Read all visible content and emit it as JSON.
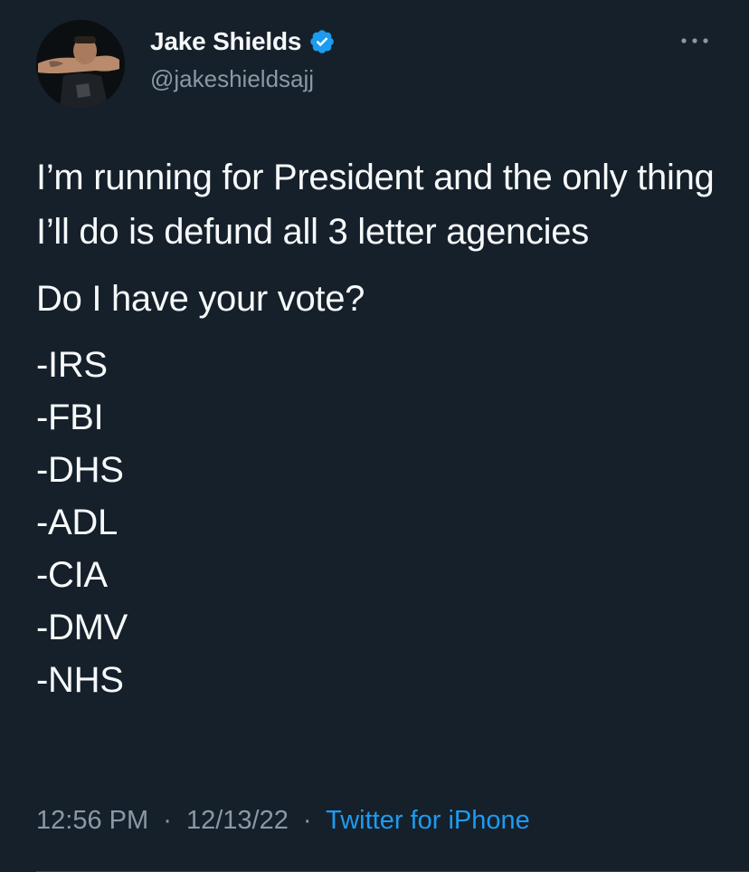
{
  "author": {
    "display_name": "Jake Shields",
    "handle": "@jakeshieldsajj",
    "avatar_icon": "profile-photo",
    "verified_icon": "verified-badge-icon",
    "verified_color": "#1d9bf0"
  },
  "more_icon": "more-horizontal-icon",
  "tweet": {
    "paragraphs": [
      "I’m running for President and the only thing I’ll do is defund all 3 letter agencies",
      "Do I have your vote?"
    ],
    "list": [
      "-IRS",
      "-FBI",
      "-DHS",
      "-ADL",
      "-CIA",
      "-DMV",
      "-NHS"
    ]
  },
  "meta": {
    "time": "12:56 PM",
    "separator": "·",
    "date": "12/13/22",
    "source": "Twitter for iPhone"
  },
  "colors": {
    "background": "#15202b",
    "text_primary": "#f7f9f9",
    "text_secondary": "#8b98a5",
    "accent": "#1d9bf0"
  }
}
